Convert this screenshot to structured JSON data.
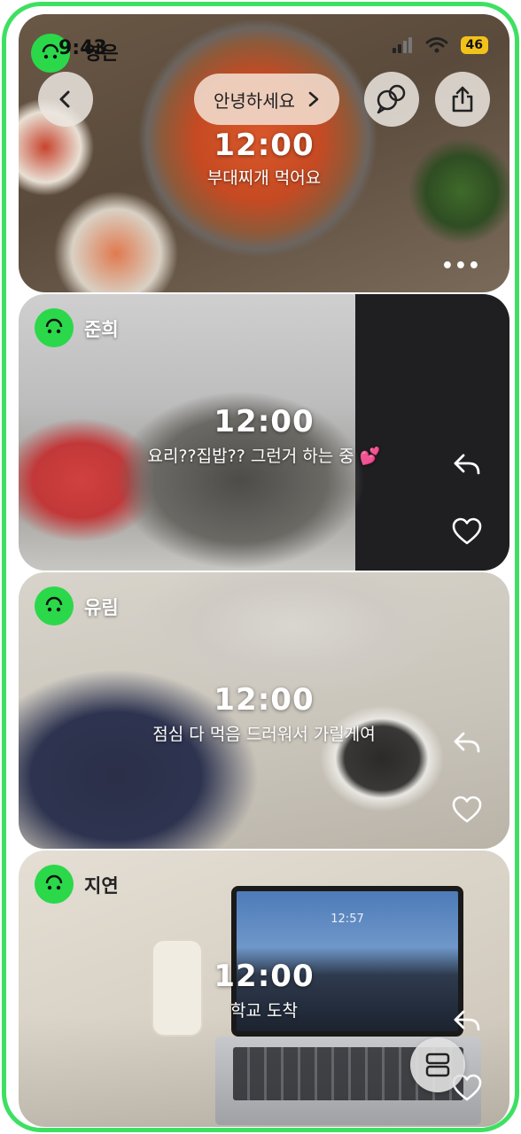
{
  "status_bar": {
    "time": "9:43",
    "battery": "46"
  },
  "header": {
    "greeting": "안녕하세요",
    "back_icon": "chevron-left-icon",
    "chat_icon": "chat-bubbles-icon",
    "share_icon": "share-icon"
  },
  "posts": [
    {
      "username": "영은",
      "time": "12:00",
      "caption": "부대찌개 먹어요"
    },
    {
      "username": "준희",
      "time": "12:00",
      "caption": "요리??집밥?? 그런거 하는 중 💕"
    },
    {
      "username": "유림",
      "time": "12:00",
      "caption": "점심 다 먹음 드러워서 가릴게여"
    },
    {
      "username": "지연",
      "time": "12:00",
      "caption": "학교 도착"
    }
  ],
  "laptop_clock": "12:57",
  "colors": {
    "accent": "#2bd84a",
    "frame": "#3ee062",
    "pill": "#f0d7c8",
    "battery": "#f3c21a"
  }
}
